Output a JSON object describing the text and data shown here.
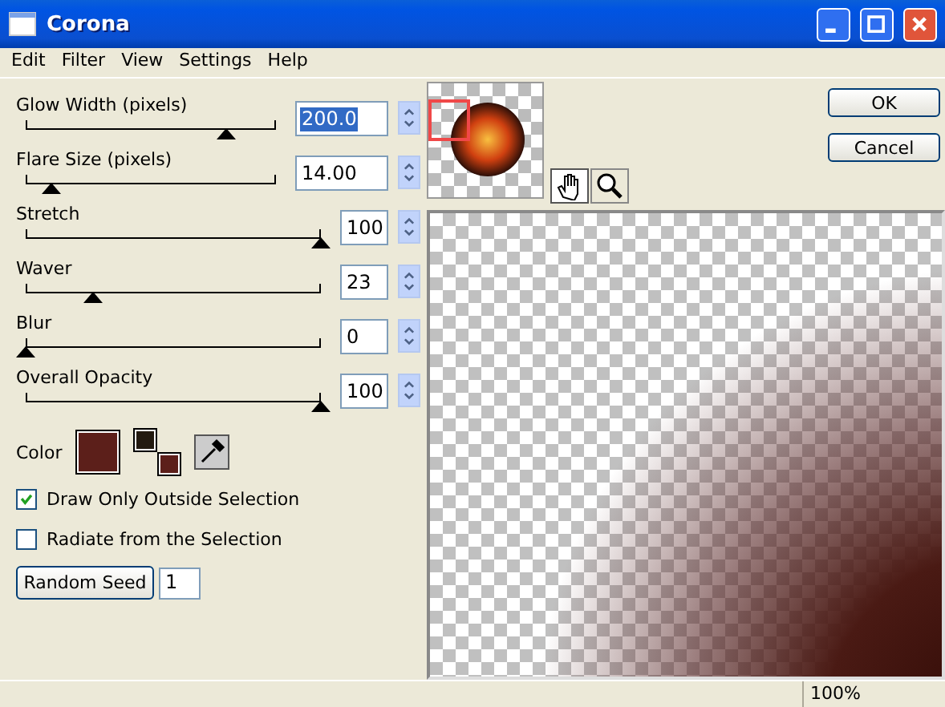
{
  "window": {
    "title": "Corona"
  },
  "menu": [
    "Edit",
    "Filter",
    "View",
    "Settings",
    "Help"
  ],
  "sliders": [
    {
      "label": "Glow Width (pixels)",
      "value": "200.0",
      "level": 0.8,
      "focused": true,
      "kind": "decimal"
    },
    {
      "label": "Flare Size (pixels)",
      "value": "14.00",
      "level": 0.1,
      "focused": false,
      "kind": "decimal"
    },
    {
      "label": "Stretch",
      "value": "100",
      "level": 1,
      "focused": false,
      "kind": "integer"
    },
    {
      "label": "Waver",
      "value": "23",
      "level": 0.23,
      "focused": false,
      "kind": "integer"
    },
    {
      "label": "Blur",
      "value": "0",
      "level": 0,
      "focused": false,
      "kind": "integer"
    },
    {
      "label": "Overall Opacity",
      "value": "100",
      "level": 1,
      "focused": false,
      "kind": "integer"
    }
  ],
  "color": {
    "label": "Color",
    "color": "#5c1f1a",
    "swatches": [
      {
        "kind": "foreground",
        "color": "#231a10"
      },
      {
        "kind": "background",
        "color": "#5c1f1a"
      }
    ]
  },
  "checkboxes": [
    {
      "label": "Draw Only Outside Selection",
      "checked": true
    },
    {
      "label": "Radiate from the Selection",
      "checked": false
    }
  ],
  "random_seed": {
    "button": "Random Seed",
    "value": "1"
  },
  "buttons": [
    "OK",
    "Cancel"
  ],
  "tools": [
    {
      "kind": "hand",
      "selected": true
    },
    {
      "kind": "zoom",
      "selected": false
    }
  ],
  "status_bar": {
    "zoom": "100%"
  }
}
